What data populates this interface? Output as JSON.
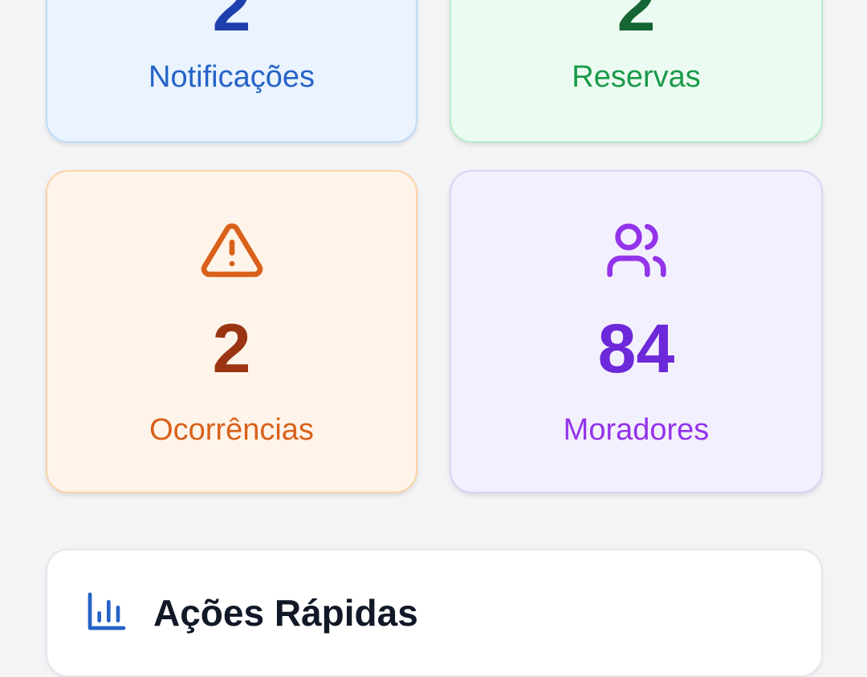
{
  "stats": {
    "notificacoes": {
      "value": "2",
      "label": "Notificações",
      "color": "#2563c7"
    },
    "reservas": {
      "value": "2",
      "label": "Reservas",
      "color": "#1a9a4a"
    },
    "ocorrencias": {
      "value": "2",
      "label": "Ocorrências",
      "icon": "warning-triangle-icon",
      "color": "#d9611a"
    },
    "moradores": {
      "value": "84",
      "label": "Moradores",
      "icon": "users-icon",
      "color": "#9333ea"
    }
  },
  "quick_actions": {
    "title": "Ações Rápidas",
    "icon": "bar-chart-icon"
  }
}
